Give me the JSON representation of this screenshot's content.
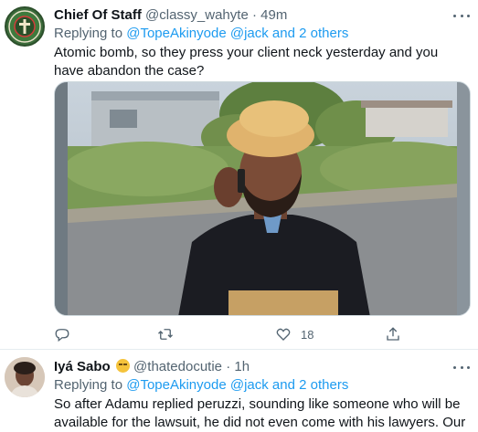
{
  "tweets": [
    {
      "name": "Chief Of Staff",
      "handle": "@classy_wahyte",
      "time": "49m",
      "replying_to_prefix": "Replying to",
      "replying_to_users": "@TopeAkinyode @jack",
      "replying_to_suffix": "and 2 others",
      "text": "Atomic bomb, so they press your client neck yesterday and you have abandon the case?",
      "like_count": "18"
    },
    {
      "name": "Iyá Sabo",
      "handle": "@thatedocutie",
      "time": "1h",
      "replying_to_prefix": "Replying to",
      "replying_to_users": "@TopeAkinyode @jack",
      "replying_to_suffix": "and 2 others",
      "text": "So after Adamu replied peruzzi, sounding like someone who will be available for the lawsuit, he did not even come with his lawyers. Our system is a joke."
    }
  ],
  "colors": {
    "link": "#1d9bf0",
    "secondary_text": "#536471",
    "primary_text": "#0f1419",
    "divider": "#e6ecf0"
  },
  "icons": [
    "more-icon",
    "reply-icon",
    "retweet-icon",
    "like-icon",
    "share-icon",
    "sleepy-face-emoji"
  ]
}
